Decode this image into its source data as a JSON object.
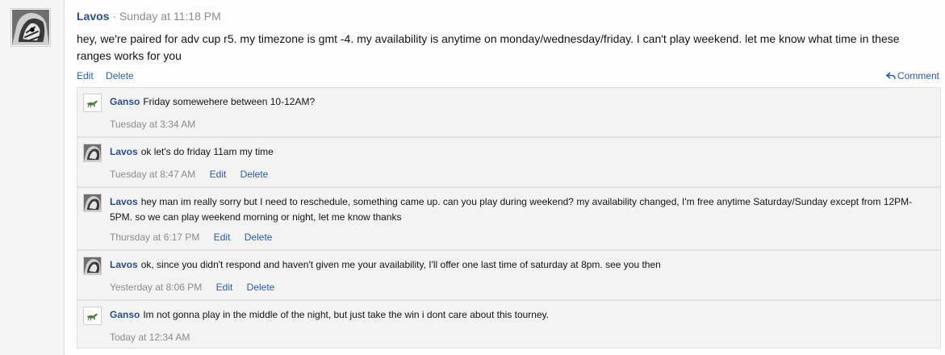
{
  "post": {
    "author": "Lavos",
    "separator": "·",
    "time": "Sunday at 11:18 PM",
    "body": "hey, we're paired for adv cup r5. my timezone is gmt -4. my availability is anytime on monday/wednesday/friday. I can't play weekend. let me know what time in these ranges works for you",
    "edit_label": "Edit",
    "delete_label": "Delete",
    "comment_label": "Comment"
  },
  "comments": [
    {
      "author": "Ganso",
      "text": "Friday somewehere between 10-12AM?",
      "time": "Tuesday at 3:34 AM",
      "avatar": "ganso-avatar-icon"
    },
    {
      "author": "Lavos",
      "text": "ok let's do friday 11am my time",
      "time": "Tuesday at 8:47 AM",
      "edit_label": "Edit",
      "delete_label": "Delete",
      "avatar": "lavos-avatar-icon"
    },
    {
      "author": "Lavos",
      "text": "hey man im really sorry but I need to reschedule, something came up. can you play during weekend? my availability changed, I'm free anytime Saturday/Sunday except from 12PM-5PM. so we can play weekend morning or night, let me know thanks",
      "time": "Thursday at 6:17 PM",
      "edit_label": "Edit",
      "delete_label": "Delete",
      "avatar": "lavos-avatar-icon"
    },
    {
      "author": "Lavos",
      "text": "ok, since you didn't respond and haven't given me your availability, I'll offer one last time of saturday at 8pm. see you then",
      "time": "Yesterday at 8:06 PM",
      "edit_label": "Edit",
      "delete_label": "Delete",
      "avatar": "lavos-avatar-icon"
    },
    {
      "author": "Ganso",
      "text": "Im not gonna play in the middle of the night, but just take the win i dont care about this tourney.",
      "time": "Today at 12:34 AM",
      "avatar": "ganso-avatar-icon"
    }
  ],
  "colors": {
    "link": "#2b5ea8",
    "username": "#2b4f8a",
    "muted": "#8c8c8c",
    "comment_bg": "#f3f3f3"
  }
}
